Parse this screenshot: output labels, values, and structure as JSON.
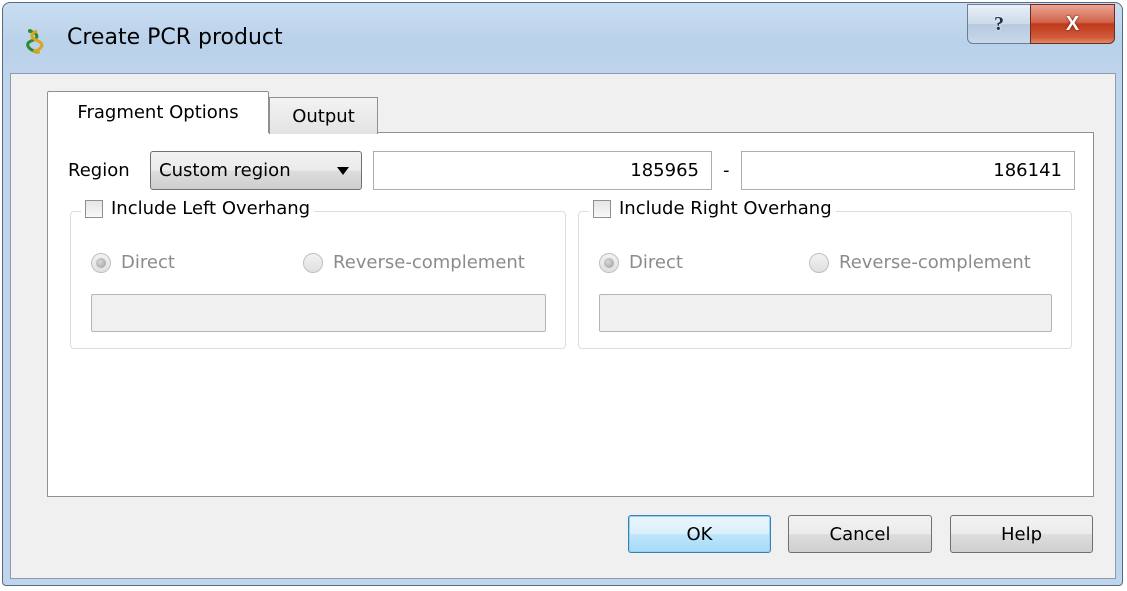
{
  "window": {
    "title": "Create PCR product",
    "help_glyph": "?",
    "close_glyph": "X",
    "colors": {
      "close_button": "#c0391b",
      "frame": "#bfd5ec",
      "default_button": "#3c7fb1"
    }
  },
  "tabs": [
    {
      "label": "Fragment Options",
      "active": true
    },
    {
      "label": "Output",
      "active": false
    }
  ],
  "fragment_options": {
    "region_label": "Region",
    "region_selected": "Custom region",
    "region_start": "185965",
    "region_separator": "-",
    "region_end": "186141",
    "left_overhang": {
      "label": "Include Left Overhang",
      "checked": false,
      "radio_direct": "Direct",
      "radio_reverse": "Reverse-complement",
      "selected": "Direct",
      "sequence": ""
    },
    "right_overhang": {
      "label": "Include Right Overhang",
      "checked": false,
      "radio_direct": "Direct",
      "radio_reverse": "Reverse-complement",
      "selected": "Direct",
      "sequence": ""
    }
  },
  "buttons": {
    "ok": "OK",
    "cancel": "Cancel",
    "help": "Help"
  },
  "icons": [
    "app-icon",
    "help-icon",
    "close-icon",
    "chevron-down-icon"
  ]
}
